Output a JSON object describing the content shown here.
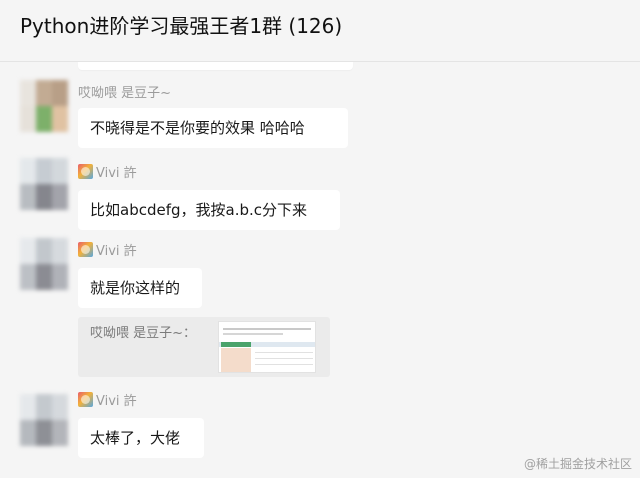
{
  "header": {
    "title": "Python进阶学习最强王者1群 (126)"
  },
  "messages": [
    {
      "sender": "哎呦喂   是豆子~",
      "text": "不晓得是不是你要的效果  哈哈哈",
      "avatar_colors": [
        "#dcd3c6",
        "#c9b6a0",
        "#b9a28c",
        "#7fb26a",
        "#e2c6a8",
        "#efe8df"
      ]
    },
    {
      "sender": "Vivi 許",
      "text": "比如abcdefg，我按a.b.c分下来",
      "avatar_colors": [
        "#cfd6dc",
        "#aab2ba",
        "#7d7f86",
        "#9a9aa3",
        "#d9dfe4",
        "#bfc3c8"
      ]
    },
    {
      "sender": "Vivi 許",
      "text": "就是你这样的",
      "avatar_colors": [
        "#d4d8dc",
        "#a9adb3",
        "#7e7f86",
        "#b7b8bd",
        "#cfd3d7",
        "#c6c8cc"
      ]
    },
    {
      "sender": "Vivi 許",
      "text": "太棒了，大佬",
      "avatar_colors": [
        "#cfd4d8",
        "#a6aab0",
        "#8d8f96",
        "#b9bbc0",
        "#d7dbde",
        "#c1c4c8"
      ]
    }
  ],
  "quote": {
    "text": "哎呦喂   是豆子~："
  },
  "watermark": "@稀土掘金技术社区"
}
